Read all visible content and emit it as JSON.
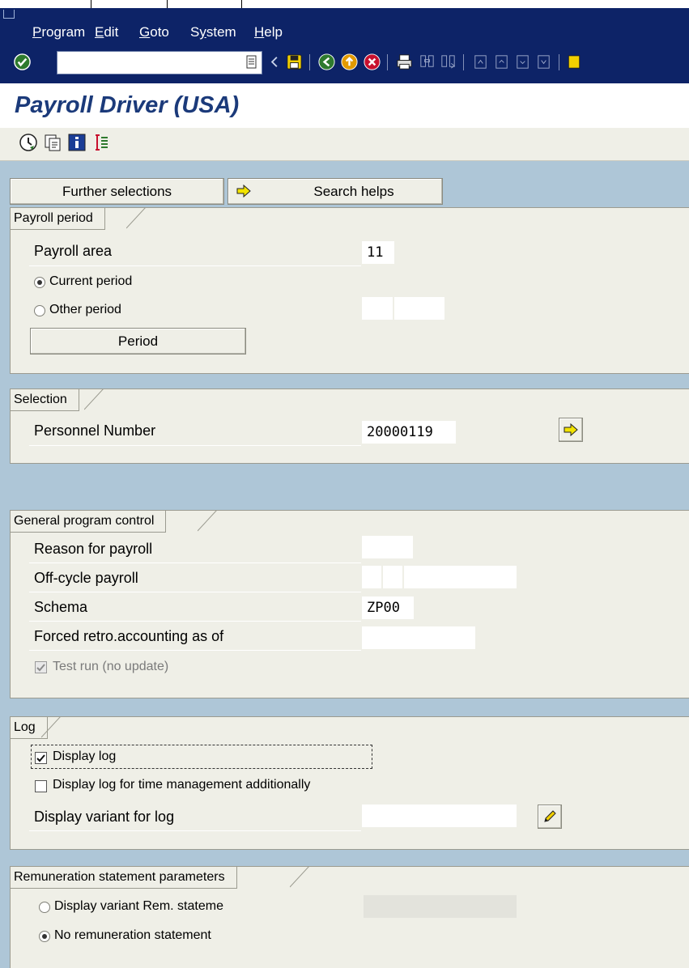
{
  "menu": {
    "program": "Program",
    "edit": "Edit",
    "goto": "Goto",
    "system": "System",
    "help": "Help"
  },
  "command_field": {
    "value": ""
  },
  "title": "Payroll Driver (USA)",
  "app_toolbar": [
    "execute-icon",
    "get-variant-icon",
    "info-icon",
    "selection-options-icon"
  ],
  "buttons": {
    "further_selections": "Further selections",
    "search_helps": "Search helps",
    "period": "Period"
  },
  "payroll_period": {
    "title": "Payroll period",
    "payroll_area_label": "Payroll area",
    "payroll_area_value": "11",
    "current_period_label": "Current period",
    "other_period_label": "Other period",
    "selected": "current"
  },
  "selection": {
    "title": "Selection",
    "personnel_number_label": "Personnel Number",
    "personnel_number_value": "20000119"
  },
  "general_program_control": {
    "title": "General program control",
    "reason_label": "Reason for payroll",
    "offcycle_label": "Off-cycle payroll",
    "schema_label": "Schema",
    "schema_value": "ZP00",
    "forced_retro_label": "Forced retro.accounting as of",
    "test_run_label": "Test run (no update)",
    "test_run_checked": true
  },
  "log": {
    "title": "Log",
    "display_log_label": "Display log",
    "display_log_checked": true,
    "time_mgmt_label": "Display log for time management additionally",
    "time_mgmt_checked": false,
    "variant_label": "Display variant for log"
  },
  "remuneration": {
    "title": "Remuneration statement parameters",
    "display_variant_label": "Display variant Rem. stateme",
    "no_statement_label": "No remuneration statement",
    "selected": "none"
  },
  "colors": {
    "menu_bg": "#0d2367",
    "content_bg": "#aec6d7",
    "panel_bg": "#efefe7",
    "title_color": "#1b3a7a"
  }
}
